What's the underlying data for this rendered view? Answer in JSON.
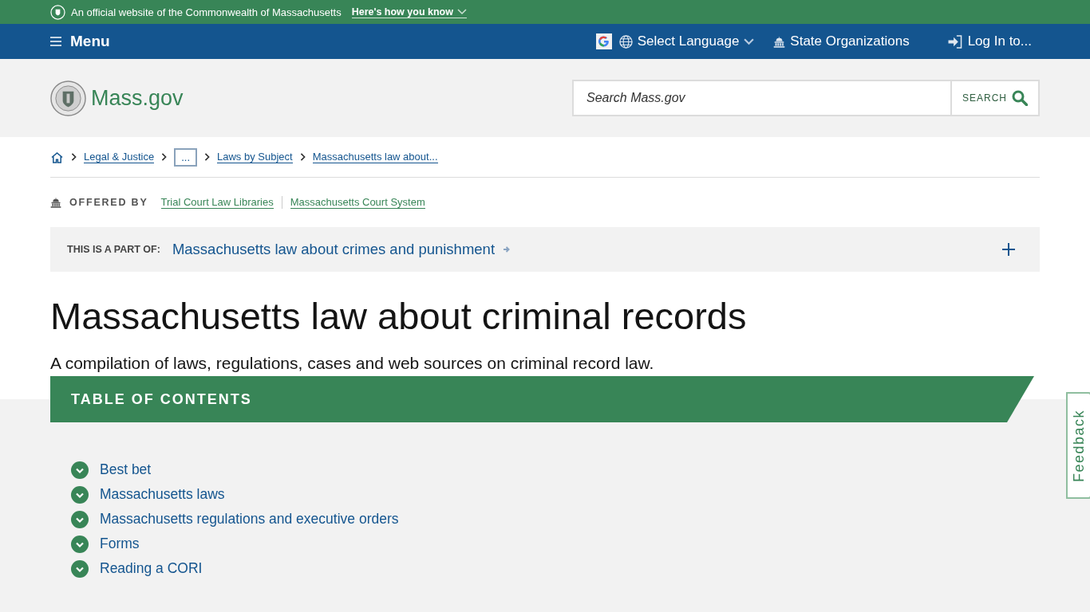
{
  "banner": {
    "text": "An official website of the Commonwealth of Massachusetts",
    "link": "Here's how you know"
  },
  "nav": {
    "menu": "Menu",
    "language": "Select Language",
    "organizations": "State Organizations",
    "login": "Log In to..."
  },
  "header": {
    "logo": "Mass.gov",
    "search": {
      "placeholder": "Search Mass.gov",
      "button": "SEARCH"
    }
  },
  "breadcrumbs": [
    {
      "kind": "link",
      "label": "Legal & Justice"
    },
    {
      "kind": "more",
      "label": "..."
    },
    {
      "kind": "link",
      "label": "Laws by Subject"
    },
    {
      "kind": "link",
      "label": "Massachusetts law about..."
    }
  ],
  "offered_by": {
    "label": "OFFERED BY",
    "organizations": [
      "Trial Court Law Libraries",
      "Massachusetts Court System"
    ]
  },
  "part_of": {
    "label": "THIS IS A PART OF:",
    "link": "Massachusetts law about crimes and punishment",
    "expanded": false
  },
  "title": "Massachusetts law about criminal records",
  "description": "A compilation of laws, regulations, cases and web sources on criminal record law.",
  "toc": {
    "heading": "TABLE OF CONTENTS",
    "items": [
      "Best bet",
      "Massachusetts laws",
      "Massachusetts regulations and executive orders",
      "Forms",
      "Reading a CORI"
    ]
  },
  "feedback": "Feedback"
}
